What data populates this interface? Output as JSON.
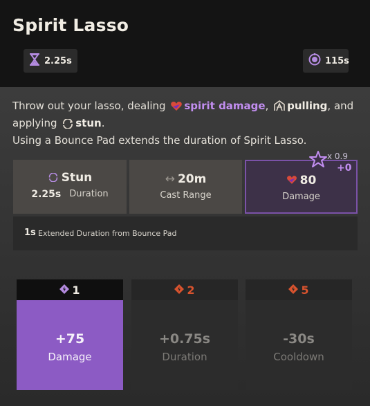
{
  "ability": {
    "title": "Spirit Lasso",
    "duration_value": "2.25s",
    "cooldown_value": "115s"
  },
  "description": {
    "p1_a": "Throw out your lasso, dealing ",
    "p1_kw1": "spirit damage",
    "p1_b": ", ",
    "p1_kw2": "pulling",
    "p1_c": ", and",
    "p1_d": "applying ",
    "p1_kw3": "stun",
    "p1_e": ".",
    "p2": "Using a Bounce Pad extends the duration of Spirit Lasso."
  },
  "stats": {
    "stun_label": "Stun",
    "stun_duration_value": "2.25s",
    "stun_duration_label": "Duration",
    "range_value": "20m",
    "range_label": "Cast Range",
    "damage_value": "80",
    "damage_label": "Damage",
    "damage_multiplier": "x 0.9",
    "damage_bonus": "+0"
  },
  "extra": {
    "amount": "1s",
    "label": "Extended Duration from Bounce Pad"
  },
  "upgrades": [
    {
      "tier": "1",
      "value": "+75",
      "label": "Damage",
      "active": true
    },
    {
      "tier": "2",
      "value": "+0.75s",
      "label": "Duration",
      "active": false
    },
    {
      "tier": "5",
      "value": "-30s",
      "label": "Cooldown",
      "active": false
    }
  ],
  "colors": {
    "spirit": "#c28ef0",
    "upgrade_active": "#8c5bc4",
    "upgrade_locked_icon": "#d9532e"
  }
}
